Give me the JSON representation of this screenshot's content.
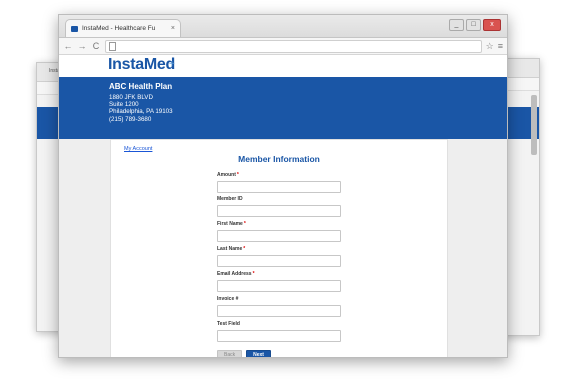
{
  "browser": {
    "tab_title": "InstaMed - Healthcare Fu",
    "tab_close": "×",
    "ghost_tab_title": "Insta",
    "window_buttons": [
      "_",
      "□",
      "x"
    ],
    "nav": {
      "back": "←",
      "forward": "→",
      "reload": "C"
    },
    "toolbar_right": {
      "star": "☆",
      "menu": "≡"
    }
  },
  "header": {
    "logo": "InstaMed",
    "plan_name": "ABC Health Plan",
    "address_lines": [
      "1880 JFK BLVD",
      "Suite 1200",
      "Philadelphia, PA 19103",
      "(215) 789-3680"
    ]
  },
  "form": {
    "my_account_link": "My Account",
    "title": "Member Information",
    "fields": [
      {
        "label": "Amount",
        "required": "*"
      },
      {
        "label": "Member ID",
        "required": ""
      },
      {
        "label": "First Name",
        "required": "*"
      },
      {
        "label": "Last Name",
        "required": "*"
      },
      {
        "label": "Email Address",
        "required": "*"
      },
      {
        "label": "Invoice #",
        "required": ""
      },
      {
        "label": "Test Field",
        "required": ""
      }
    ],
    "back_button": "Back",
    "next_button": "Next"
  },
  "colors": {
    "brand": "#1a56a6",
    "required": "#dd0000"
  }
}
